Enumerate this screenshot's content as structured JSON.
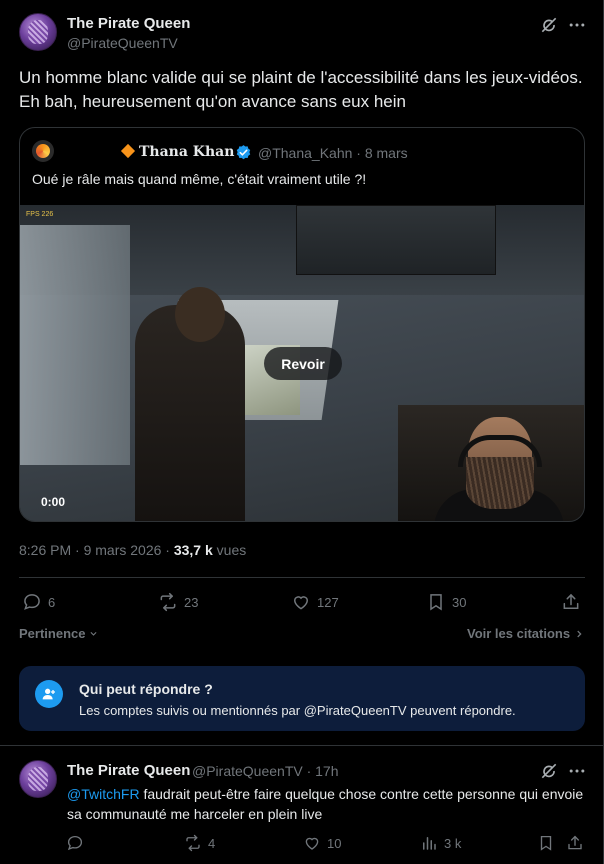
{
  "post": {
    "display_name": "The Pirate Queen",
    "handle": "@PirateQueenTV",
    "text_line1": "Un homme blanc valide qui se plaint de l'accessibilité dans les jeux-vidéos.",
    "text_line2": "Eh bah, heureusement qu'on avance sans eux hein",
    "time": "8:26 PM · 9 mars 2026 · ",
    "views": "33,7 k",
    "views_suffix": " vues"
  },
  "quoted": {
    "display_name": "Thana Khan",
    "handle_and_date": "@Thana_Kahn · 8 mars",
    "text": "Oué je râle mais quand même, c'était vraiment utile ?!",
    "video": {
      "replay_label": "Revoir",
      "timestamp": "0:00",
      "fps_label": "FPS 226"
    }
  },
  "actions": {
    "replies": "6",
    "reposts": "23",
    "likes": "127",
    "bookmarks": "30"
  },
  "sort": {
    "label": "Pertinence"
  },
  "quotes_link": {
    "label": "Voir les citations"
  },
  "reply_restriction": {
    "title": "Qui peut répondre ?",
    "description": "Les comptes suivis ou mentionnés par @PirateQueenTV peuvent répondre."
  },
  "reply": {
    "display_name": "The Pirate Queen",
    "handle_time": "@PirateQueenTV · 17h",
    "mention": "@TwitchFR",
    "text_rest": " faudrait peut-être faire quelque chose contre cette personne qui envoie sa communauté me harceler en  plein live",
    "reposts": "4",
    "likes": "10",
    "views": "3 k"
  },
  "colors": {
    "accent": "#1d9bf0",
    "background": "#000000",
    "muted": "#71767b",
    "reply_box": "#0d1d3b"
  },
  "icons": [
    "grok-icon",
    "more-icon",
    "verified-icon",
    "reply-icon",
    "repost-icon",
    "like-icon",
    "bookmark-icon",
    "share-icon",
    "views-icon",
    "chevron-down-icon",
    "chevron-right-icon",
    "people-icon"
  ]
}
